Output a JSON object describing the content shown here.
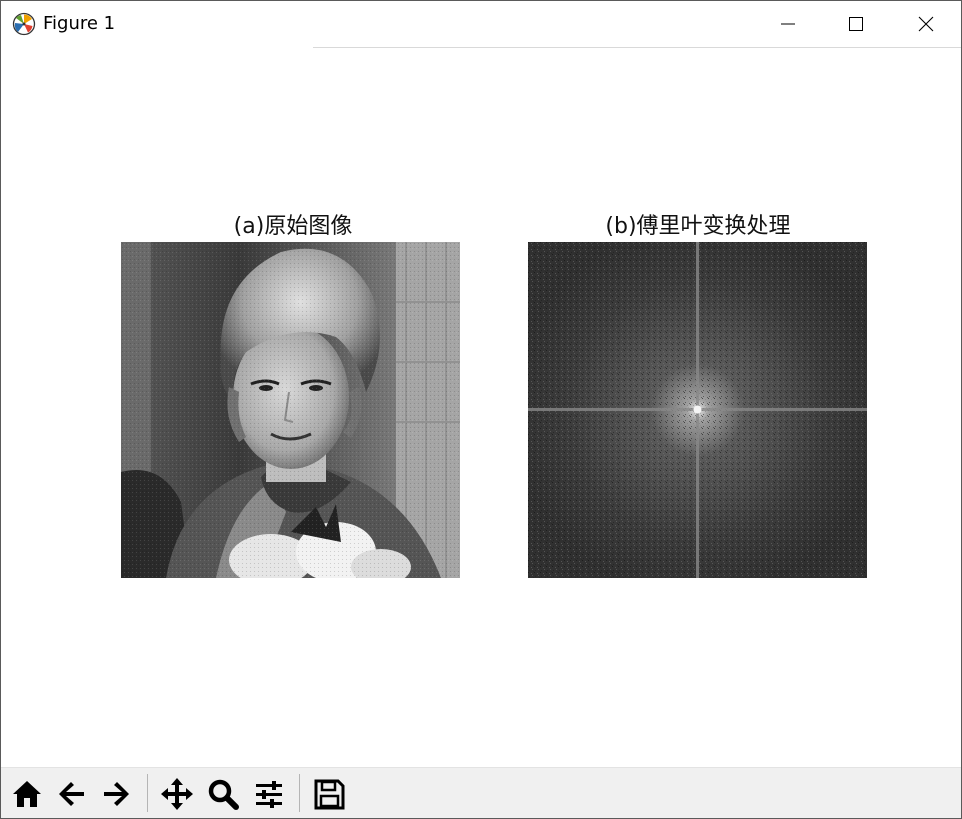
{
  "window": {
    "title": "Figure 1",
    "icon": "matplotlib-icon",
    "controls": [
      "minimize-icon",
      "maximize-icon",
      "close-icon"
    ]
  },
  "figure": {
    "panels": [
      {
        "title": "(a)原始图像",
        "content": "grayscale portrait photo of a woman"
      },
      {
        "title": "(b)傅里叶变换处理",
        "content": "Fourier magnitude spectrum with bright center and cross lines"
      }
    ]
  },
  "toolbar": {
    "buttons": [
      "home-icon",
      "back-icon",
      "forward-icon",
      "pan-icon",
      "zoom-icon",
      "configure-subplots-icon",
      "save-icon"
    ]
  },
  "colors": {
    "toolbar_bg": "#f0f0f0",
    "window_border": "#5a5a5a",
    "spectrum_bg": "#3d3d3d"
  }
}
